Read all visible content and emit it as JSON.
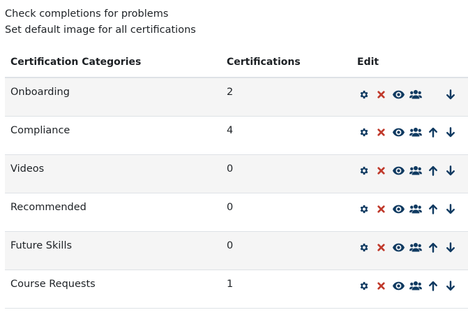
{
  "links": [
    {
      "label": "Check completions for problems"
    },
    {
      "label": "Set default image for all certifications"
    }
  ],
  "table": {
    "headers": {
      "category": "Certification Categories",
      "count": "Certifications",
      "edit": "Edit"
    },
    "rows": [
      {
        "name": "Onboarding",
        "count": "2",
        "can_move_up": false,
        "can_move_down": true
      },
      {
        "name": "Compliance",
        "count": "4",
        "can_move_up": true,
        "can_move_down": true
      },
      {
        "name": "Videos",
        "count": "0",
        "can_move_up": true,
        "can_move_down": true
      },
      {
        "name": "Recommended",
        "count": "0",
        "can_move_up": true,
        "can_move_down": true
      },
      {
        "name": "Future Skills",
        "count": "0",
        "can_move_up": true,
        "can_move_down": true
      },
      {
        "name": "Course Requests",
        "count": "1",
        "can_move_up": true,
        "can_move_down": true
      }
    ]
  },
  "icons": {
    "settings": "gear-icon",
    "delete": "delete-x-icon",
    "visibility": "eye-icon",
    "cohorts": "users-icon",
    "move_up": "arrow-up-icon",
    "move_down": "arrow-down-icon"
  },
  "colors": {
    "icon": "#0f3a61",
    "delete": "#c0392b",
    "row_stripe": "#f5f5f5",
    "border": "#dee2e6",
    "text": "#1d2125"
  }
}
